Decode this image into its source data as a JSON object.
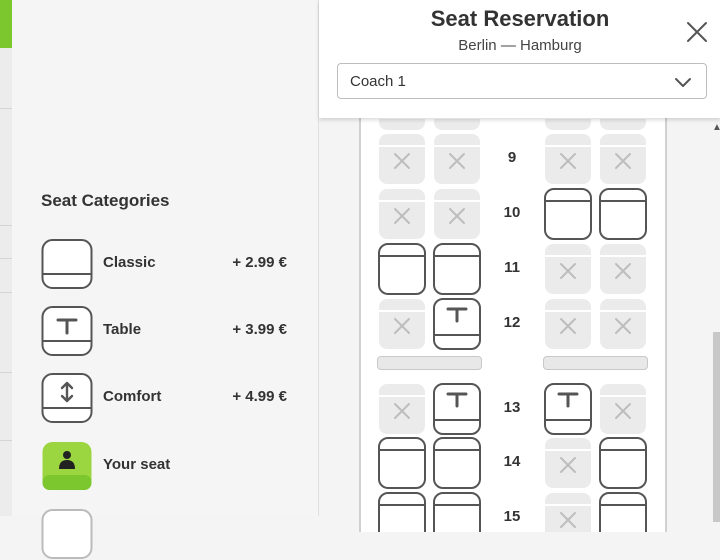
{
  "modal": {
    "title": "Seat Reservation",
    "route": "Berlin — Hamburg",
    "coach_select": {
      "value": "Coach 1"
    }
  },
  "legend": {
    "title": "Seat Categories",
    "items": [
      {
        "label": "Classic",
        "price": "+ 2.99 €",
        "icon": "classic-seat-icon"
      },
      {
        "label": "Table",
        "price": "+ 3.99 €",
        "icon": "table-seat-icon"
      },
      {
        "label": "Comfort",
        "price": "+ 4.99 €",
        "icon": "comfort-seat-icon"
      },
      {
        "label": "Your seat",
        "price": "",
        "icon": "your-seat-icon"
      }
    ]
  },
  "colors": {
    "accent": "#7cc62e",
    "occupied": "#ebebeb",
    "seat_outline": "#555555"
  },
  "seat_map": {
    "rows": [
      {
        "number": "9",
        "seats": [
          "occupied",
          "occupied",
          "occupied",
          "occupied"
        ]
      },
      {
        "number": "10",
        "seats": [
          "occupied",
          "occupied",
          "classic",
          "classic"
        ]
      },
      {
        "number": "11",
        "seats": [
          "classic",
          "classic",
          "occupied",
          "occupied"
        ]
      },
      {
        "number": "12",
        "seats": [
          "occupied",
          "table",
          "occupied",
          "occupied"
        ]
      },
      {
        "number": "13",
        "seats": [
          "occupied",
          "table",
          "table",
          "occupied"
        ]
      },
      {
        "number": "14",
        "seats": [
          "classic",
          "classic",
          "occupied",
          "classic"
        ]
      },
      {
        "number": "15",
        "seats": [
          "classic",
          "classic",
          "occupied",
          "classic"
        ]
      }
    ]
  }
}
